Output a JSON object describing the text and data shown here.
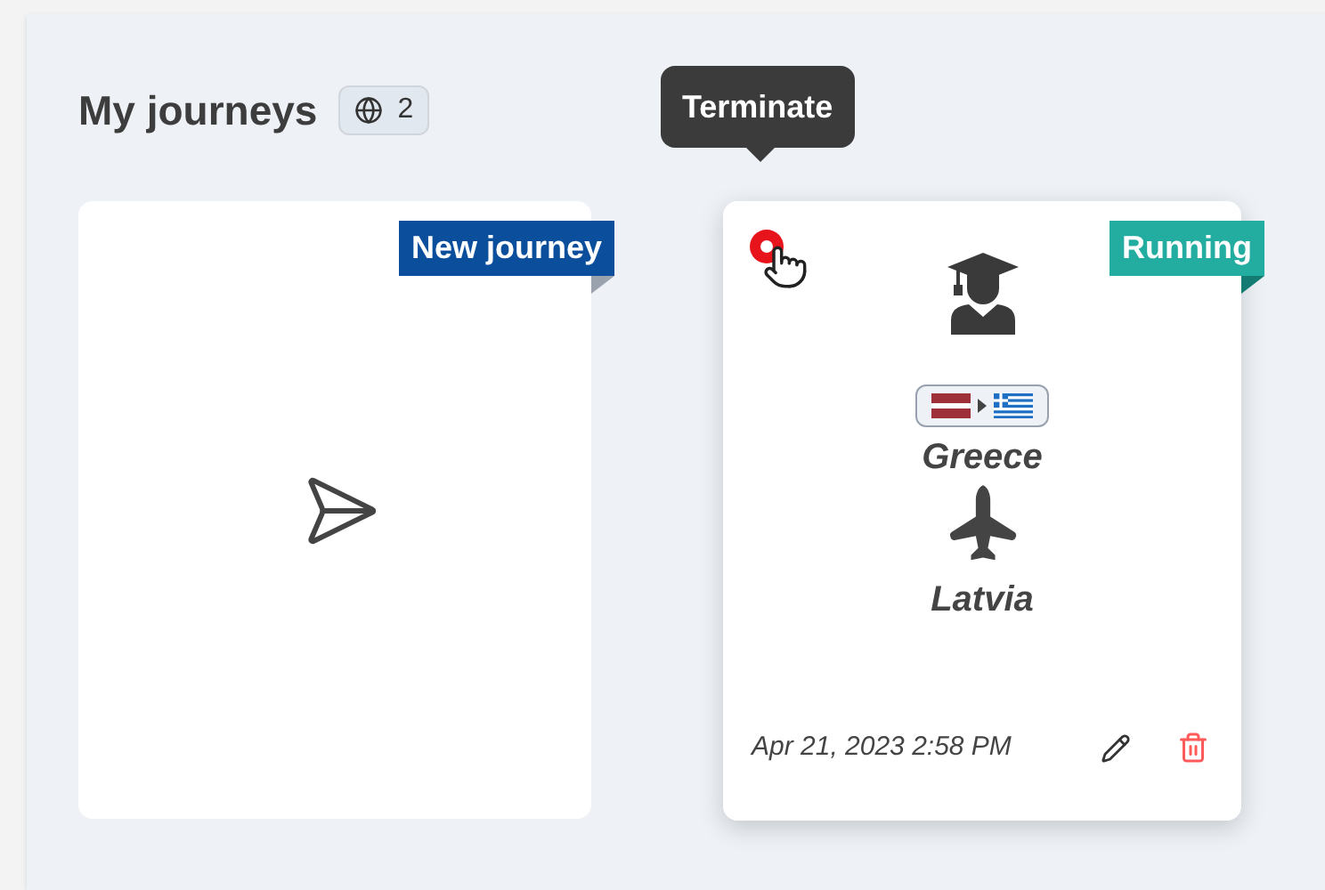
{
  "header": {
    "title": "My journeys",
    "count": "2"
  },
  "tooltip": {
    "text": "Terminate"
  },
  "new_card": {
    "badge": "New journey"
  },
  "journeys": [
    {
      "status": "Running",
      "destination": "Greece",
      "origin": "Latvia",
      "date": "Apr 21, 2023 2:58 PM"
    }
  ]
}
